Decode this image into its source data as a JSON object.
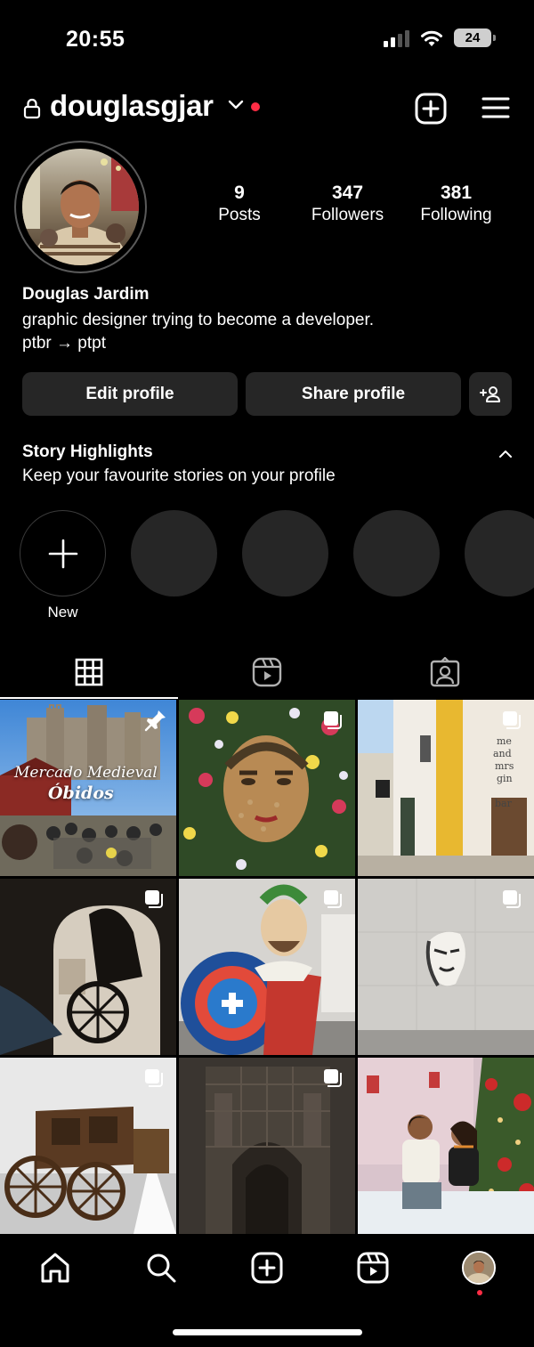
{
  "status_bar": {
    "time": "20:55",
    "battery": "24"
  },
  "header": {
    "username": "douglasgjar"
  },
  "profile": {
    "stats": [
      {
        "value": "9",
        "label": "Posts"
      },
      {
        "value": "347",
        "label": "Followers"
      },
      {
        "value": "381",
        "label": "Following"
      }
    ],
    "full_name": "Douglas Jardim",
    "bio": [
      "graphic designer trying to become a developer.",
      "ptbr → ptpt"
    ]
  },
  "buttons": {
    "edit": "Edit profile",
    "share": "Share profile"
  },
  "highlights": {
    "title": "Story Highlights",
    "subtitle": "Keep your favourite stories on your profile",
    "new_label": "New"
  },
  "posts": {
    "first_post_overlay": [
      "Mercado Medieval",
      "Óbidos"
    ]
  },
  "colors": {
    "background": "#000000",
    "button_bg": "#262626",
    "notification_red": "#ff2d45"
  }
}
